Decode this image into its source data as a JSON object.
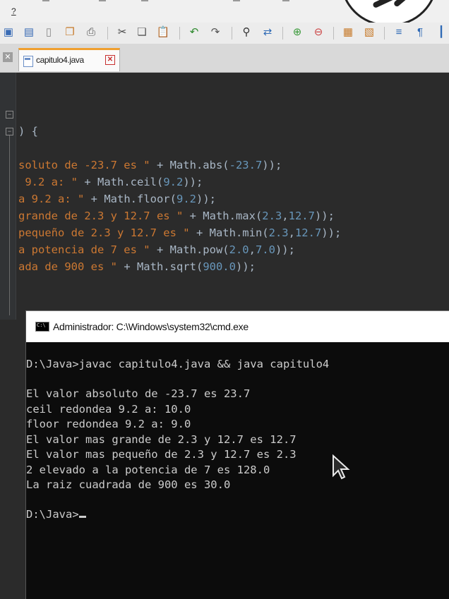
{
  "menubar": {
    "help_label": "?"
  },
  "toolbar": {
    "icons": [
      "save-icon",
      "save-all-icon",
      "new-file-icon",
      "copy-file-icon",
      "print-icon",
      "cut-icon",
      "copy-icon",
      "paste-icon",
      "undo-icon",
      "redo-icon",
      "find-icon",
      "replace-icon",
      "zoom-in-icon",
      "zoom-out-icon",
      "window-icon",
      "window-2-icon",
      "wrap-icon",
      "pilcrow-icon",
      "indent-guide-icon"
    ]
  },
  "tab": {
    "label": "capitulo4.java"
  },
  "editor": {
    "lines": [
      [
        {
          "t": ") {",
          "c": "tok"
        }
      ],
      [
        {
          "t": "soluto de -23.7 es \"",
          "c": "str"
        },
        {
          "t": " + Math.abs(",
          "c": "tok"
        },
        {
          "t": "-23.7",
          "c": "num"
        },
        {
          "t": "));",
          "c": "tok"
        }
      ],
      [
        {
          "t": " 9.2 a: \"",
          "c": "str"
        },
        {
          "t": " + Math.ceil(",
          "c": "tok"
        },
        {
          "t": "9.2",
          "c": "num"
        },
        {
          "t": "));",
          "c": "tok"
        }
      ],
      [
        {
          "t": "a 9.2 a: \"",
          "c": "str"
        },
        {
          "t": " + Math.floor(",
          "c": "tok"
        },
        {
          "t": "9.2",
          "c": "num"
        },
        {
          "t": "));",
          "c": "tok"
        }
      ],
      [
        {
          "t": "grande de 2.3 y 12.7 es \"",
          "c": "str"
        },
        {
          "t": " + Math.max(",
          "c": "tok"
        },
        {
          "t": "2.3",
          "c": "num"
        },
        {
          "t": ",",
          "c": "tok"
        },
        {
          "t": "12.7",
          "c": "num"
        },
        {
          "t": "));",
          "c": "tok"
        }
      ],
      [
        {
          "t": "pequeño de 2.3 y 12.7 es \"",
          "c": "str"
        },
        {
          "t": " + Math.min(",
          "c": "tok"
        },
        {
          "t": "2.3",
          "c": "num"
        },
        {
          "t": ",",
          "c": "tok"
        },
        {
          "t": "12.7",
          "c": "num"
        },
        {
          "t": "));",
          "c": "tok"
        }
      ],
      [
        {
          "t": "a potencia de 7 es \"",
          "c": "str"
        },
        {
          "t": " + Math.pow(",
          "c": "tok"
        },
        {
          "t": "2.0",
          "c": "num"
        },
        {
          "t": ",",
          "c": "tok"
        },
        {
          "t": "7.0",
          "c": "num"
        },
        {
          "t": "));",
          "c": "tok"
        }
      ],
      [
        {
          "t": "ada de 900 es \"",
          "c": "str"
        },
        {
          "t": " + Math.sqrt(",
          "c": "tok"
        },
        {
          "t": "900.0",
          "c": "num"
        },
        {
          "t": "));",
          "c": "tok"
        }
      ]
    ]
  },
  "cmd": {
    "title": "Administrador: C:\\Windows\\system32\\cmd.exe",
    "command": "D:\\Java>javac capitulo4.java && java capitulo4",
    "output": [
      "El valor absoluto de -23.7 es 23.7",
      "ceil redondea 9.2 a: 10.0",
      "floor redondea 9.2 a: 9.0",
      "El valor mas grande de 2.3 y 12.7 es 12.7",
      "El valor mas pequeño de 2.3 y 12.7 es 2.3",
      "2 elevado a la potencia de 7 es 128.0",
      "La raiz cuadrada de 900 es 30.0"
    ],
    "prompt": "D:\\Java>"
  }
}
